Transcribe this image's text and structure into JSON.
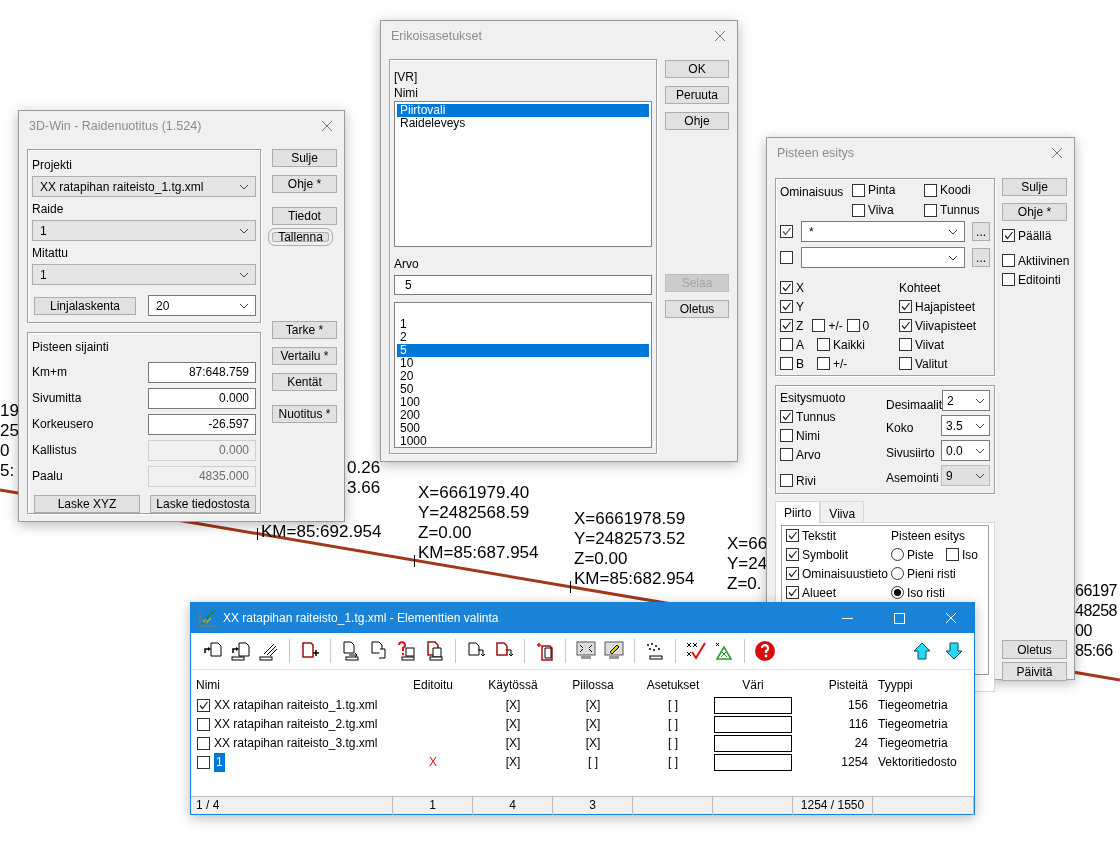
{
  "canvas": {
    "labels": [
      {
        "lines": [
          "19",
          "25",
          "0",
          "5:"
        ]
      },
      {
        "lines": [
          "0.26",
          "3.66"
        ]
      },
      {
        "lines": [
          "KM=85:692.954"
        ]
      },
      {
        "lines": [
          "X=6661979.40",
          "Y=2482568.59",
          "Z=0.00",
          "KM=85:687.954"
        ]
      },
      {
        "lines": [
          "X=6661978.59",
          "Y=2482573.52",
          "Z=0.00",
          "KM=85:682.954"
        ]
      },
      {
        "lines": [
          "X=66",
          "Y=24",
          "Z=0."
        ]
      },
      {
        "lines": [
          "66197",
          "48258",
          "00",
          "85:66"
        ]
      }
    ]
  },
  "raidenuotitus": {
    "title": "3D-Win - Raidenuotitus  (1.524)",
    "projekti_group": {
      "fields": [
        {
          "label": "Projekti",
          "value": "XX ratapihan raiteisto_1.tg.xml"
        },
        {
          "label": "Raide",
          "value": "1"
        },
        {
          "label": "Mitattu",
          "value": "1"
        }
      ],
      "linjalaskenta": "Linjalaskenta",
      "interval": "20"
    },
    "sijainti_group": {
      "title": "Pisteen sijainti",
      "rows": [
        {
          "label": "Km+m",
          "value": "87:648.759",
          "disabled": false
        },
        {
          "label": "Sivumitta",
          "value": "0.000",
          "disabled": false
        },
        {
          "label": "Korkeusero",
          "value": "-26.597",
          "disabled": false
        },
        {
          "label": "Kallistus",
          "value": "0.000",
          "disabled": true
        },
        {
          "label": "Paalu",
          "value": "4835.000",
          "disabled": true
        }
      ],
      "buttons": [
        "Laske XYZ",
        "Laske tiedostosta"
      ]
    },
    "button_groups": [
      [
        {
          "label": "Sulje",
          "highlighted": false
        },
        {
          "label": "Ohje *",
          "highlighted": false
        }
      ],
      [
        {
          "label": "Tiedot",
          "highlighted": false
        },
        {
          "label": "Tallenna",
          "highlighted": true
        }
      ],
      [
        {
          "label": "Tarke *",
          "highlighted": false
        },
        {
          "label": "Vertailu *",
          "highlighted": false
        },
        {
          "label": "Kentät",
          "highlighted": false
        }
      ],
      [
        {
          "label": "Nuotitus *",
          "highlighted": false
        }
      ]
    ]
  },
  "erikoisasetukset": {
    "title": "Erikoisasetukset",
    "section": "[VR]",
    "nimi_label": "Nimi",
    "nimi_items": [
      {
        "text": "Piirtovali",
        "selected": true
      },
      {
        "text": "Raideleveys",
        "selected": false
      }
    ],
    "arvo_label": "Arvo",
    "arvo_value": "5",
    "arvo_items": [
      {
        "text": "1",
        "selected": false
      },
      {
        "text": "2",
        "selected": false
      },
      {
        "text": "5",
        "selected": true
      },
      {
        "text": "10",
        "selected": false
      },
      {
        "text": "20",
        "selected": false
      },
      {
        "text": "50",
        "selected": false
      },
      {
        "text": "100",
        "selected": false
      },
      {
        "text": "200",
        "selected": false
      },
      {
        "text": "500",
        "selected": false
      },
      {
        "text": "1000",
        "selected": false
      }
    ],
    "button_groups": [
      [
        {
          "label": "OK",
          "disabled": false
        },
        {
          "label": "Peruuta",
          "disabled": false
        },
        {
          "label": "Ohje",
          "disabled": false
        }
      ],
      [
        {
          "label": "Selaa",
          "disabled": true
        },
        {
          "label": "Oletus",
          "disabled": false
        }
      ]
    ]
  },
  "pisteen_esitys": {
    "title": "Pisteen esitys",
    "ominaisuus": {
      "label": "Ominaisuus",
      "checks": [
        {
          "label": "Pinta",
          "checked": false
        },
        {
          "label": "Koodi",
          "checked": false
        },
        {
          "label": "Viiva",
          "checked": false
        },
        {
          "label": "Tunnus",
          "checked": false
        }
      ],
      "filters": [
        {
          "checked": true,
          "value": "*",
          "more": "..."
        },
        {
          "checked": false,
          "more": "..."
        }
      ],
      "coordinate_rows": [
        [
          {
            "label": "X",
            "checked": true
          }
        ],
        [
          {
            "label": "Y",
            "checked": true
          }
        ],
        [
          {
            "label": "Z",
            "checked": true
          },
          {
            "label": "+/-",
            "checked": false
          },
          {
            "label": "0",
            "checked": false
          }
        ],
        [
          {
            "label": "A",
            "checked": false
          },
          {
            "label": "Kaikki",
            "checked": false
          }
        ],
        [
          {
            "label": "B",
            "checked": false
          },
          {
            "label": "+/-",
            "checked": false
          }
        ]
      ],
      "kohteet_label": "Kohteet",
      "kohteet": [
        {
          "label": "Hajapisteet",
          "checked": true
        },
        {
          "label": "Viivapisteet",
          "checked": true
        },
        {
          "label": "Viivat",
          "checked": false
        },
        {
          "label": "Valitut",
          "checked": false
        }
      ]
    },
    "esitysmuoto": {
      "label": "Esitysmuoto",
      "checks": [
        {
          "label": "Tunnus",
          "checked": true
        },
        {
          "label": "Nimi",
          "checked": false
        },
        {
          "label": "Arvo",
          "checked": false
        },
        {
          "label": "Rivi",
          "checked": false
        }
      ],
      "selects": [
        {
          "label": "Desimaalit",
          "value": "2",
          "disabled": false
        },
        {
          "label": "Koko",
          "value": "3.5",
          "disabled": false
        },
        {
          "label": "Sivusiirto",
          "value": "0.0",
          "disabled": false
        },
        {
          "label": "Asemointi",
          "value": "9",
          "disabled": true
        }
      ]
    },
    "tabs": [
      {
        "label": "Piirto",
        "selected": true
      },
      {
        "label": "Viiva",
        "selected": false
      }
    ],
    "piirto": {
      "checks": [
        {
          "label": "Tekstit",
          "checked": true
        },
        {
          "label": "Symbolit",
          "checked": true
        },
        {
          "label": "Ominaisuustieto",
          "checked": true
        },
        {
          "label": "Alueet",
          "checked": true
        }
      ],
      "pisteen_esitys_label": "Pisteen esitys",
      "radios": [
        {
          "label": "Piste",
          "selected": false
        },
        {
          "label": "Pieni risti",
          "selected": false
        },
        {
          "label": "Iso risti",
          "selected": true
        }
      ],
      "iso": {
        "label": "Iso",
        "checked": false
      }
    },
    "side_buttons": [
      "Sulje",
      "Ohje *"
    ],
    "side_checks": [
      {
        "label": "Päällä",
        "checked": true
      },
      {
        "label": "Aktiivinen",
        "checked": false
      },
      {
        "label": "Editointi",
        "checked": false
      }
    ],
    "bottom_buttons": [
      "Oletus",
      "Päivitä"
    ]
  },
  "elementit": {
    "title": "XX ratapihan raiteisto_1.tg.xml - Elementtien valinta",
    "columns": [
      "Nimi",
      "Editoitu",
      "Käytössä",
      "Piilossa",
      "Asetukset",
      "Väri",
      "Pisteitä",
      "Tyyppi"
    ],
    "rows": [
      {
        "checked": true,
        "name": "XX ratapihan raiteisto_1.tg.xml",
        "editing": false,
        "kaytossa": "[X]",
        "piilossa": "[X]",
        "asetukset": "[ ]",
        "pisteita": "156",
        "tyyppi": "Tiegeometria"
      },
      {
        "checked": false,
        "name": "XX ratapihan raiteisto_2.tg.xml",
        "editing": false,
        "kaytossa": "[X]",
        "piilossa": "[X]",
        "asetukset": "[ ]",
        "pisteita": "116",
        "tyyppi": "Tiegeometria"
      },
      {
        "checked": false,
        "name": "XX ratapihan raiteisto_3.tg.xml",
        "editing": false,
        "kaytossa": "[X]",
        "piilossa": "[X]",
        "asetukset": "[ ]",
        "pisteita": "24",
        "tyyppi": "Tiegeometria"
      },
      {
        "checked": false,
        "name": "1",
        "editing": true,
        "editoitu": "X",
        "kaytossa": "[X]",
        "piilossa": "[ ]",
        "asetukset": "[ ]",
        "pisteita": "1254",
        "tyyppi": "Vektoritiedosto"
      }
    ],
    "status_bar": {
      "count": "1 / 4",
      "editoitu": "1",
      "kaytossa": "4",
      "piilossa": "3",
      "pisteita": "1254 / 1550"
    }
  }
}
